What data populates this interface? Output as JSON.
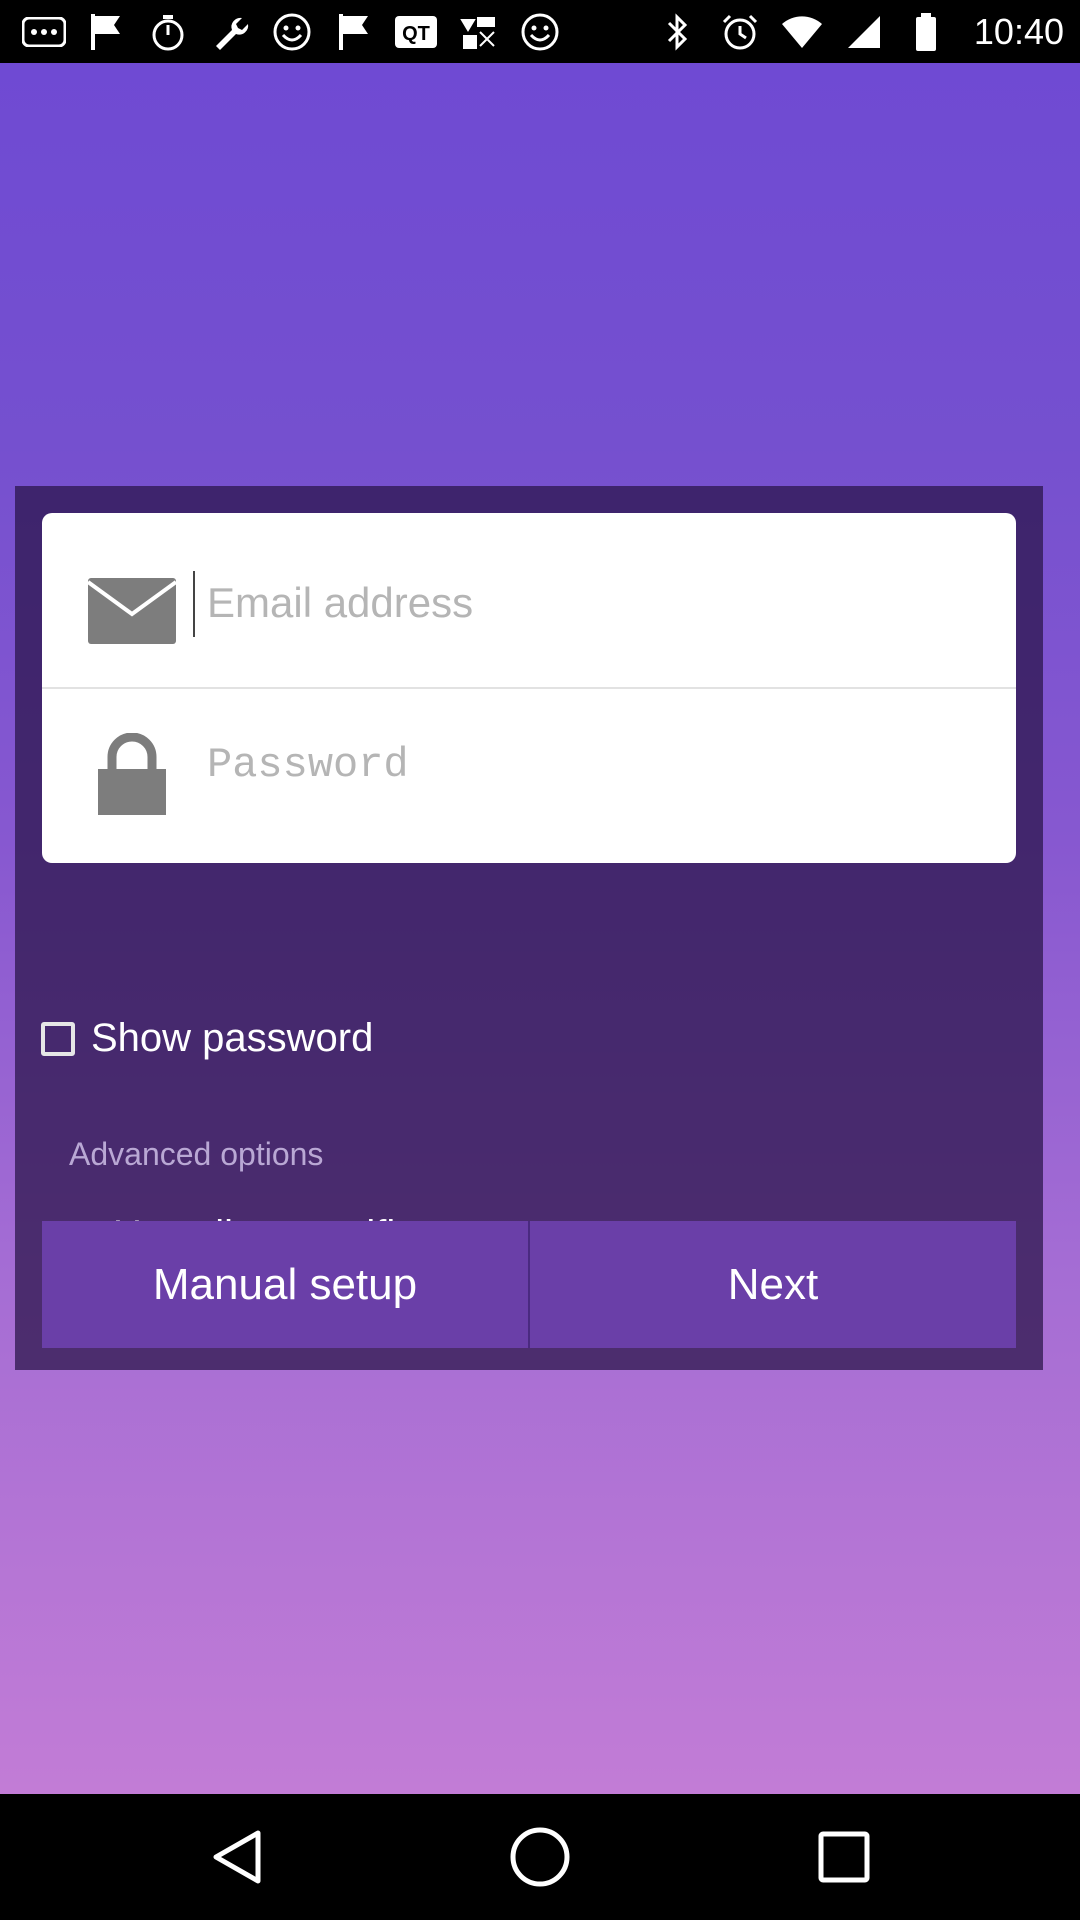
{
  "statusbar": {
    "time": "10:40",
    "icons_left": [
      "more-icon",
      "flag-icon",
      "timer-icon",
      "wrench-icon",
      "smiley-icon",
      "flag-icon",
      "qt-app-icon",
      "app-icon",
      "smiley-icon"
    ],
    "icons_right": [
      "bluetooth-icon",
      "alarm-icon",
      "wifi-icon",
      "signal-icon",
      "battery-icon"
    ]
  },
  "form": {
    "email_placeholder": "Email address",
    "password_placeholder": "Password",
    "show_password_label": "Show password",
    "advanced_options_label": "Advanced options",
    "use_client_certificate_label": "Use client certificate"
  },
  "buttons": {
    "manual_setup": "Manual setup",
    "next": "Next"
  },
  "colors": {
    "accent": "#6a3fa8",
    "card_bg": "#2c1a4a",
    "gradient_top": "#6f4ad3",
    "gradient_bottom": "#c27cd6"
  }
}
